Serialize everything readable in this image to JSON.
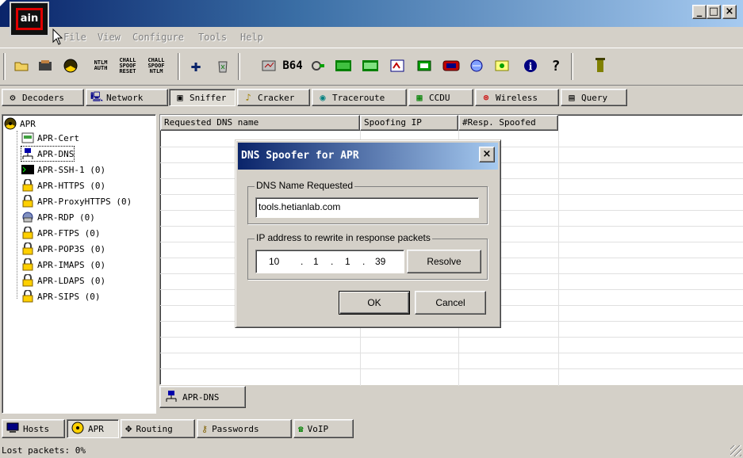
{
  "titlebar": {
    "icon_text": "ain",
    "min": "_",
    "max": "□",
    "close": "×"
  },
  "menu": [
    "File",
    "View",
    "Configure",
    "Tools",
    "Help"
  ],
  "toolbar": {
    "ntlm_auth": "NTLM AUTH",
    "chall_spoof_reset": "CHALL SPOOF RESET",
    "chall_spoof_ntlm": "CHALL SPOOF NTLM",
    "b64": "B64"
  },
  "tabs": [
    "Decoders",
    "Network",
    "Sniffer",
    "Cracker",
    "Traceroute",
    "CCDU",
    "Wireless",
    "Query"
  ],
  "tree": {
    "root": "APR",
    "items": [
      "APR-Cert",
      "APR-DNS",
      "APR-SSH-1  (0)",
      "APR-HTTPS  (0)",
      "APR-ProxyHTTPS  (0)",
      "APR-RDP  (0)",
      "APR-FTPS  (0)",
      "APR-POP3S  (0)",
      "APR-IMAPS  (0)",
      "APR-LDAPS  (0)",
      "APR-SIPS  (0)"
    ]
  },
  "list": {
    "columns": [
      "Requested DNS name",
      "Spoofing IP",
      "#Resp. Spoofed"
    ]
  },
  "bottom_tab": "APR-DNS",
  "nav_tabs": [
    "Hosts",
    "APR",
    "Routing",
    "Passwords",
    "VoIP"
  ],
  "status": "Lost packets:   0%",
  "dialog": {
    "title": "DNS Spoofer for APR",
    "close": "×",
    "group1_label": "DNS Name Requested",
    "dns_name": "tools.hetianlab.com",
    "group2_label": "IP address to rewrite in response packets",
    "ip": [
      "10",
      "1",
      "1",
      "39"
    ],
    "ip_dot": ".",
    "resolve": "Resolve",
    "ok": "OK",
    "cancel": "Cancel"
  }
}
